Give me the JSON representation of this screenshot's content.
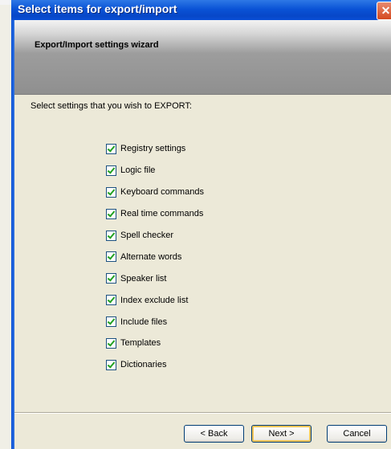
{
  "window": {
    "title": "Select items for export/import",
    "close_glyph": "✕"
  },
  "header": {
    "title": "Export/Import settings wizard"
  },
  "main": {
    "prompt": "Select settings that you wish to EXPORT:",
    "items": [
      {
        "label": "Registry settings",
        "checked": true
      },
      {
        "label": "Logic file",
        "checked": true
      },
      {
        "label": "Keyboard commands",
        "checked": true
      },
      {
        "label": "Real time commands",
        "checked": true
      },
      {
        "label": "Spell checker",
        "checked": true
      },
      {
        "label": "Alternate words",
        "checked": true
      },
      {
        "label": "Speaker list",
        "checked": true
      },
      {
        "label": "Index exclude list",
        "checked": true
      },
      {
        "label": "Include files",
        "checked": true
      },
      {
        "label": "Templates",
        "checked": true
      },
      {
        "label": "Dictionaries",
        "checked": true
      }
    ]
  },
  "footer": {
    "back_label": "< Back",
    "next_label": "Next >",
    "cancel_label": "Cancel"
  },
  "colors": {
    "titlebar": "#0a53d6",
    "close_button": "#d4491f",
    "header_band": "#9d9d9d",
    "dialog_bg": "#ece9d8",
    "checkmark": "#21a121"
  }
}
